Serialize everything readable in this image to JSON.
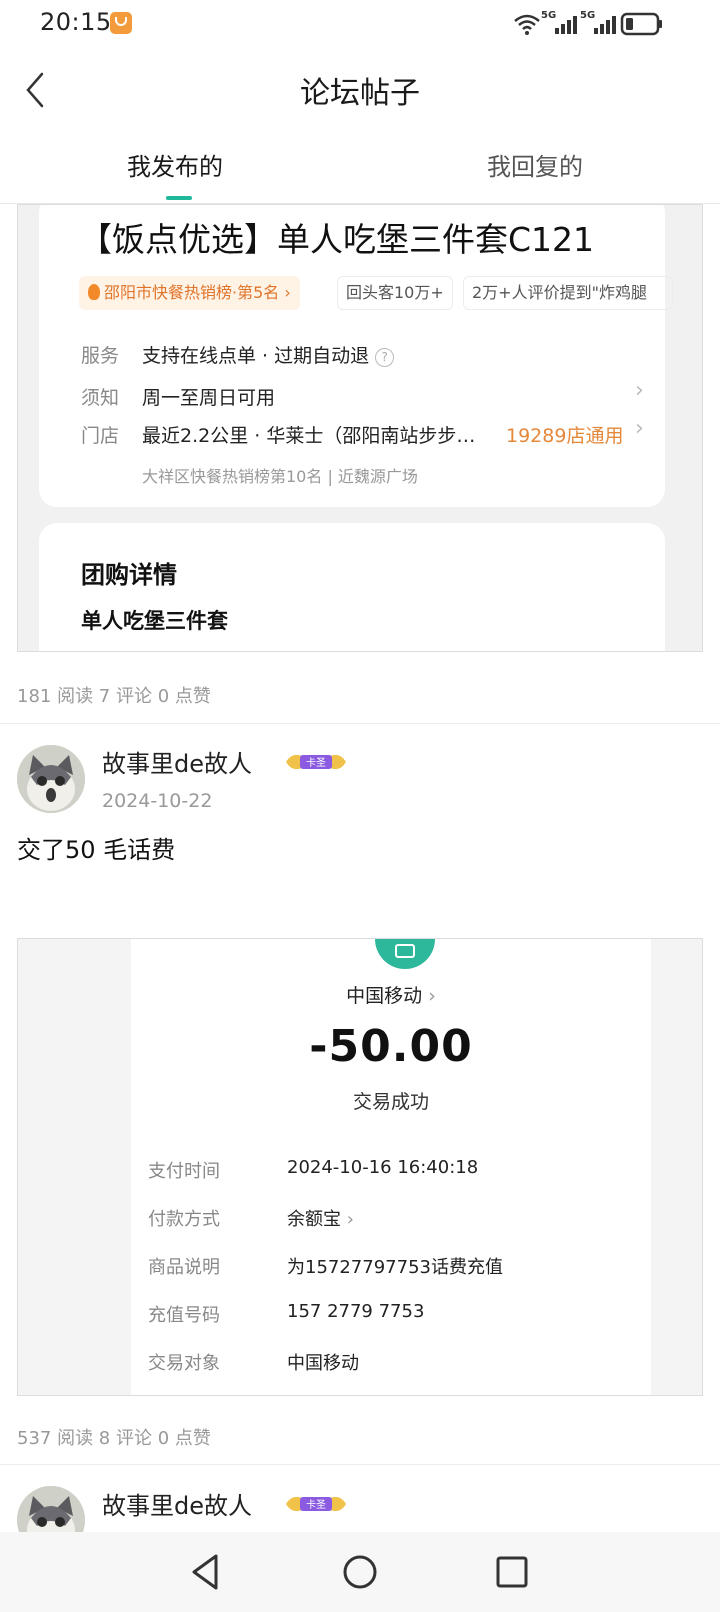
{
  "status_bar": {
    "time": "20:15",
    "signal1_label": "5G",
    "signal2_label": "5G",
    "icons": [
      "app-notification-icon",
      "wifi-icon",
      "signal-icon",
      "battery-icon"
    ]
  },
  "header": {
    "title": "论坛帖子",
    "back_icon": "chevron-left-icon"
  },
  "tabs": [
    {
      "label": "我发布的",
      "active": true
    },
    {
      "label": "我回复的",
      "active": false
    }
  ],
  "accent_color": "#1fb89a",
  "posts": [
    {
      "image": {
        "deal_title": "【饭点优选】单人吃堡三件套C121",
        "chips": {
          "rank": "邵阳市快餐热销榜·第5名",
          "repeat": "回头客10万+",
          "reviews": "2万+人评价提到\"炸鸡腿"
        },
        "rows": {
          "service_label": "服务",
          "service_value": "支持在线点单 · 过期自动退",
          "notice_label": "须知",
          "notice_value": "周一至周日可用",
          "store_label": "门店",
          "store_value": "最近2.2公里 · 华莱士（邵阳南站步步…",
          "store_count": "19289店通用",
          "store_meta": "大祥区快餐热销榜第10名  |  近魏源广场"
        },
        "group_title": "团购详情",
        "group_sub": "单人吃堡三件套"
      },
      "stats": "181 阅读 7 评论 0 点赞"
    },
    {
      "author": "故事里de故人",
      "badge_text": "卡圣",
      "date": "2024-10-22",
      "text": "交了50 毛话费",
      "receipt": {
        "payee": "中国移动",
        "amount": "-50.00",
        "status": "交易成功",
        "details": [
          {
            "label": "支付时间",
            "value": "2024-10-16 16:40:18"
          },
          {
            "label": "付款方式",
            "value": "余额宝"
          },
          {
            "label": "商品说明",
            "value": "为15727797753话费充值"
          },
          {
            "label": "充值号码",
            "value": "157 2779 7753"
          },
          {
            "label": "交易对象",
            "value": "中国移动"
          }
        ]
      },
      "stats": "537 阅读 8 评论 0 点赞"
    },
    {
      "author": "故事里de故人",
      "badge_text": "卡圣"
    }
  ],
  "nav_bar": {
    "buttons": [
      "back-triangle-icon",
      "home-circle-icon",
      "recents-square-icon"
    ]
  }
}
